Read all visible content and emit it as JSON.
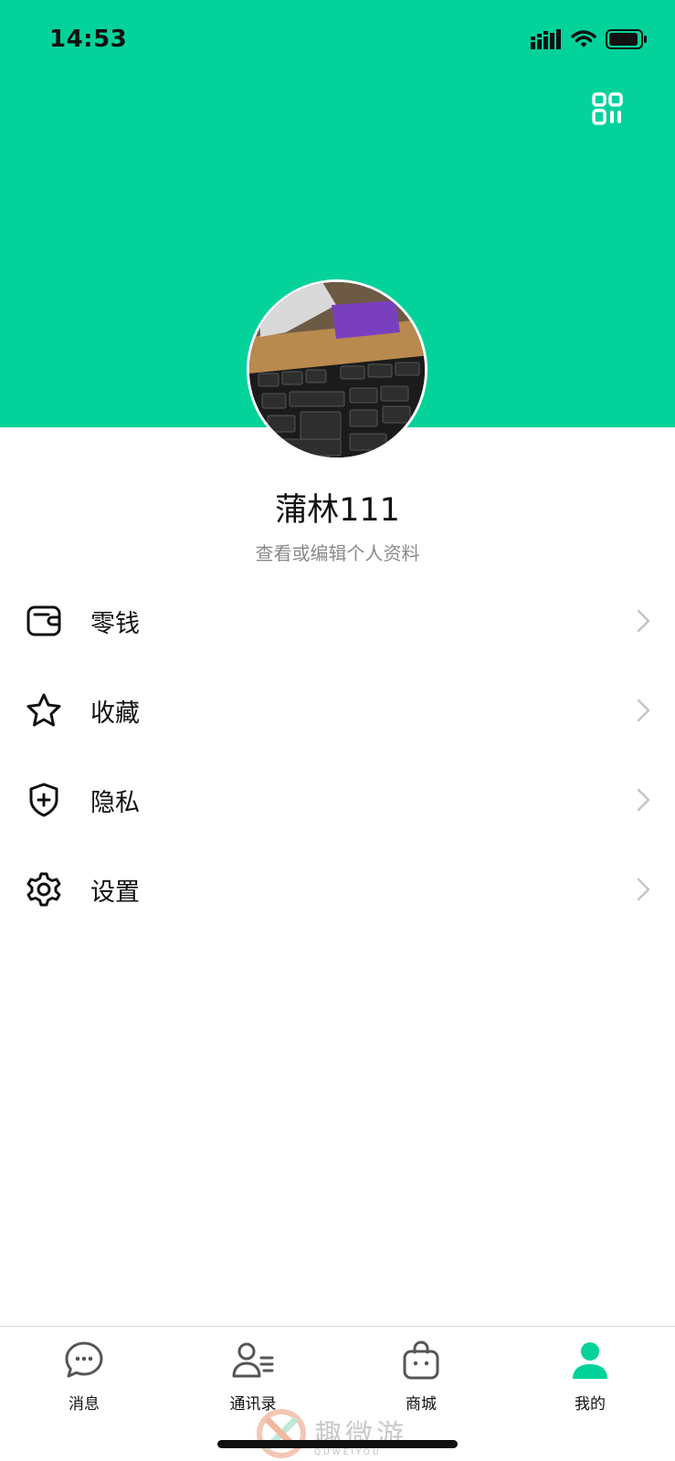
{
  "status_bar": {
    "time": "14:53",
    "icons": [
      "cellular-signal-icon",
      "wifi-icon",
      "battery-icon"
    ]
  },
  "header": {
    "background_color": "#04d29b",
    "qr_icon": "qr-code-icon"
  },
  "profile": {
    "name": "蒲林111",
    "edit_label": "查看或编辑个人资料"
  },
  "menu": {
    "items": [
      {
        "label": "零钱",
        "icon": "wallet-icon"
      },
      {
        "label": "收藏",
        "icon": "star-icon"
      },
      {
        "label": "隐私",
        "icon": "shield-icon"
      },
      {
        "label": "设置",
        "icon": "gear-icon"
      }
    ]
  },
  "tabs": [
    {
      "label": "消息",
      "icon": "chat-bubble-icon",
      "active": false
    },
    {
      "label": "通讯录",
      "icon": "contacts-icon",
      "active": false
    },
    {
      "label": "商城",
      "icon": "shopping-bag-icon",
      "active": false
    },
    {
      "label": "我的",
      "icon": "person-icon",
      "active": true
    }
  ],
  "watermark": {
    "text": "趣微游",
    "sub": "QUWEIYOU"
  },
  "colors": {
    "accent": "#04d29b",
    "text": "#111111",
    "secondary_text": "#8a8a8a",
    "chevron": "#c4c4c4"
  }
}
